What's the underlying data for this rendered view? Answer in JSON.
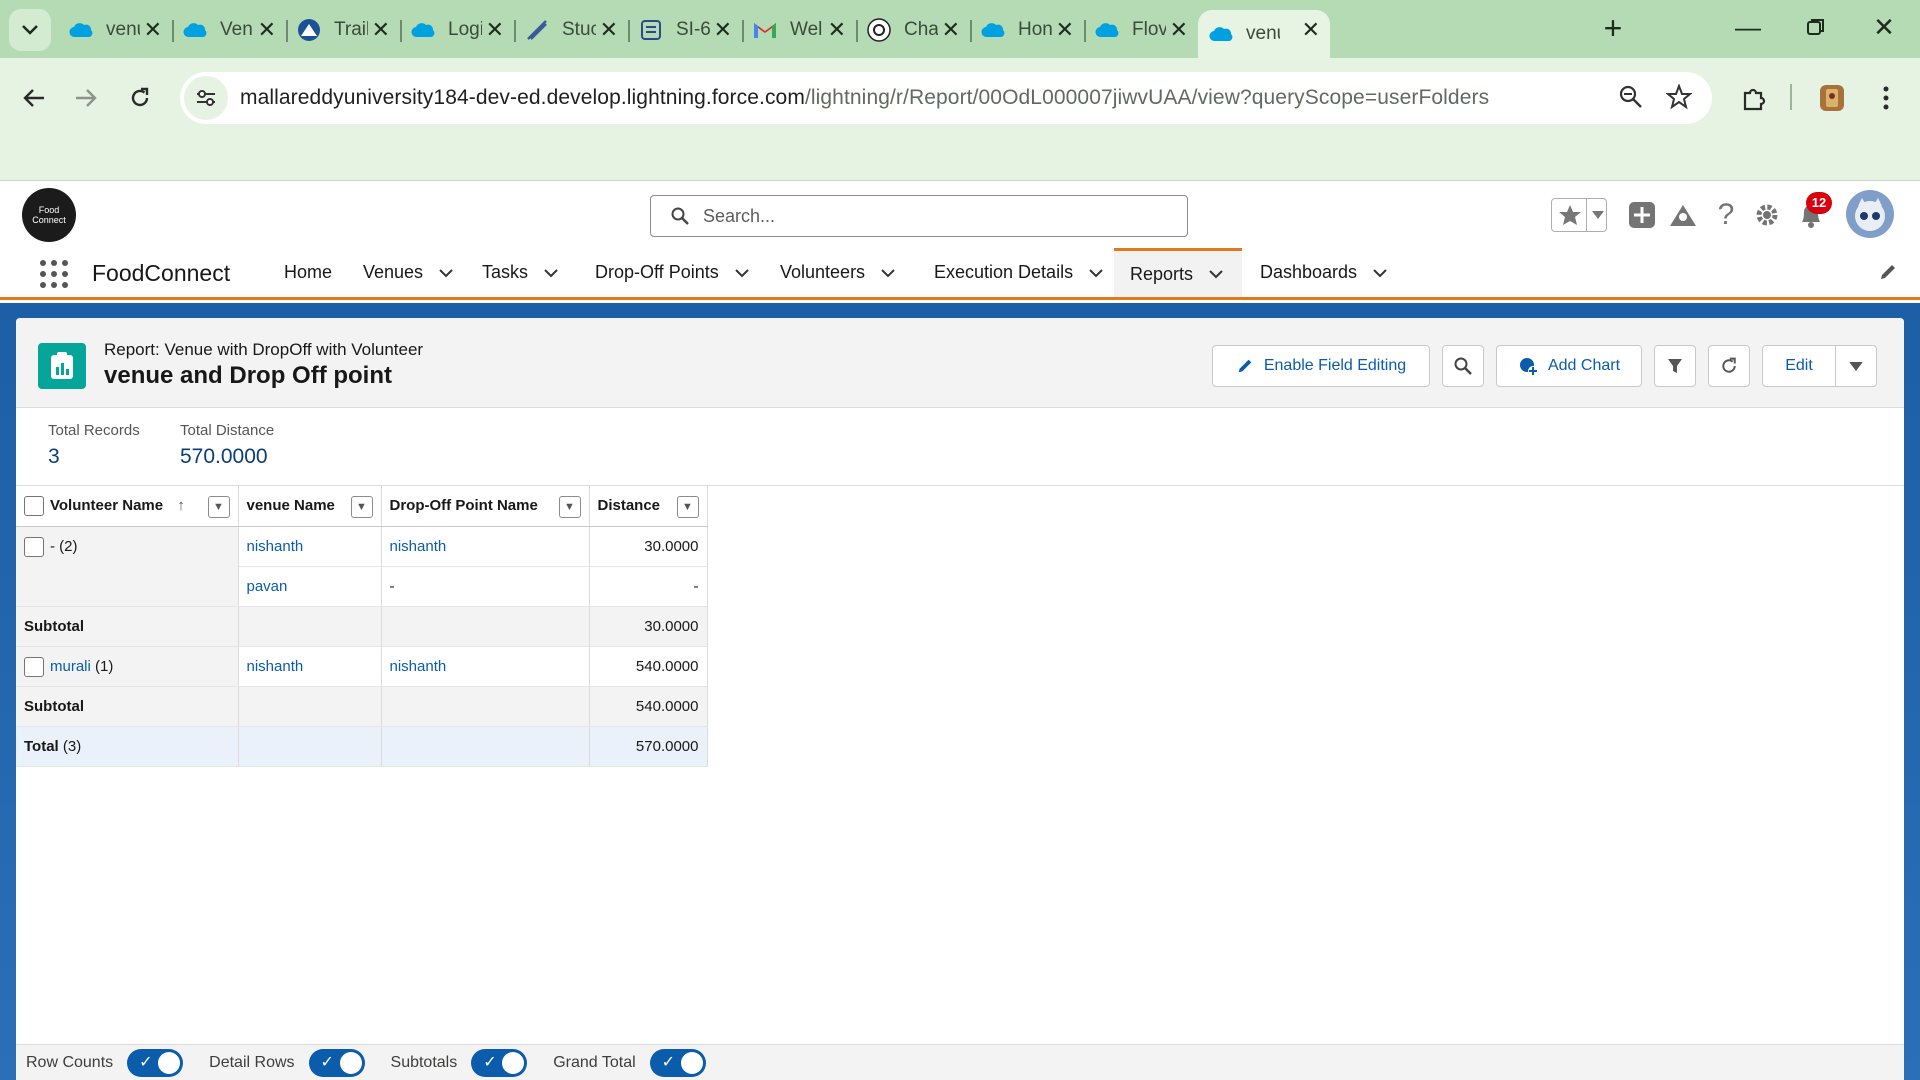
{
  "browser": {
    "tabs": [
      {
        "label": "venu",
        "icon": "salesforce-cloud-icon"
      },
      {
        "label": "Venu",
        "icon": "salesforce-cloud-icon"
      },
      {
        "label": "Trail",
        "icon": "trailhead-icon"
      },
      {
        "label": "Logi",
        "icon": "salesforce-cloud-icon"
      },
      {
        "label": "Stuc",
        "icon": "study-icon"
      },
      {
        "label": "SI-6",
        "icon": "form-icon"
      },
      {
        "label": "Wel",
        "icon": "gmail-icon"
      },
      {
        "label": "Chat",
        "icon": "chatgpt-icon"
      },
      {
        "label": "Hon",
        "icon": "salesforce-cloud-icon"
      },
      {
        "label": "Flov",
        "icon": "salesforce-cloud-icon"
      },
      {
        "label": "venu",
        "icon": "salesforce-cloud-icon",
        "active": true
      }
    ],
    "url_host": "mallareddyuniversity184-dev-ed.develop.lightning.force.com",
    "url_path": "/lightning/r/Report/00OdL000007jiwvUAA/view?queryScope=userFolders"
  },
  "sf": {
    "search_placeholder": "Search...",
    "notification_count": "12",
    "app_name": "FoodConnect",
    "logo_text": "Food Connect",
    "nav": [
      {
        "label": "Home",
        "has_menu": false
      },
      {
        "label": "Venues",
        "has_menu": true
      },
      {
        "label": "Tasks",
        "has_menu": true
      },
      {
        "label": "Drop-Off Points",
        "has_menu": true
      },
      {
        "label": "Volunteers",
        "has_menu": true
      },
      {
        "label": "Execution Details",
        "has_menu": true
      },
      {
        "label": "Reports",
        "has_menu": true,
        "active": true
      },
      {
        "label": "Dashboards",
        "has_menu": true
      }
    ]
  },
  "report": {
    "type_label": "Report: Venue with DropOff with Volunteer",
    "title": "venue and Drop Off point",
    "buttons": {
      "enable_field_editing": "Enable Field Editing",
      "add_chart": "Add Chart",
      "edit": "Edit"
    },
    "summary": [
      {
        "label": "Total Records",
        "value": "3"
      },
      {
        "label": "Total Distance",
        "value": "570.0000"
      }
    ],
    "columns": [
      "Volunteer Name",
      "venue Name",
      "Drop-Off Point Name",
      "Distance"
    ],
    "sort_indicator": "↑",
    "groups": [
      {
        "name": "-",
        "count": "(2)",
        "is_link": false,
        "rows": [
          {
            "venue": "nishanth",
            "dropoff": "nishanth",
            "distance": "30.0000"
          },
          {
            "venue": "pavan",
            "dropoff": "-",
            "distance": "-"
          }
        ],
        "subtotal_label": "Subtotal",
        "subtotal": "30.0000"
      },
      {
        "name": "murali",
        "count": "(1)",
        "is_link": true,
        "rows": [
          {
            "venue": "nishanth",
            "dropoff": "nishanth",
            "distance": "540.0000"
          }
        ],
        "subtotal_label": "Subtotal",
        "subtotal": "540.0000"
      }
    ],
    "total_label": "Total",
    "total_count": "(3)",
    "total": "570.0000"
  },
  "footer": {
    "toggles": [
      {
        "label": "Row Counts",
        "on": true
      },
      {
        "label": "Detail Rows",
        "on": true
      },
      {
        "label": "Subtotals",
        "on": true
      },
      {
        "label": "Grand Total",
        "on": true
      }
    ]
  },
  "colors": {
    "brand_blue": "#0b5cab",
    "accent_orange": "#e07b1c",
    "report_icon": "#06a59a",
    "chrome_green": "#b5dbb5"
  }
}
